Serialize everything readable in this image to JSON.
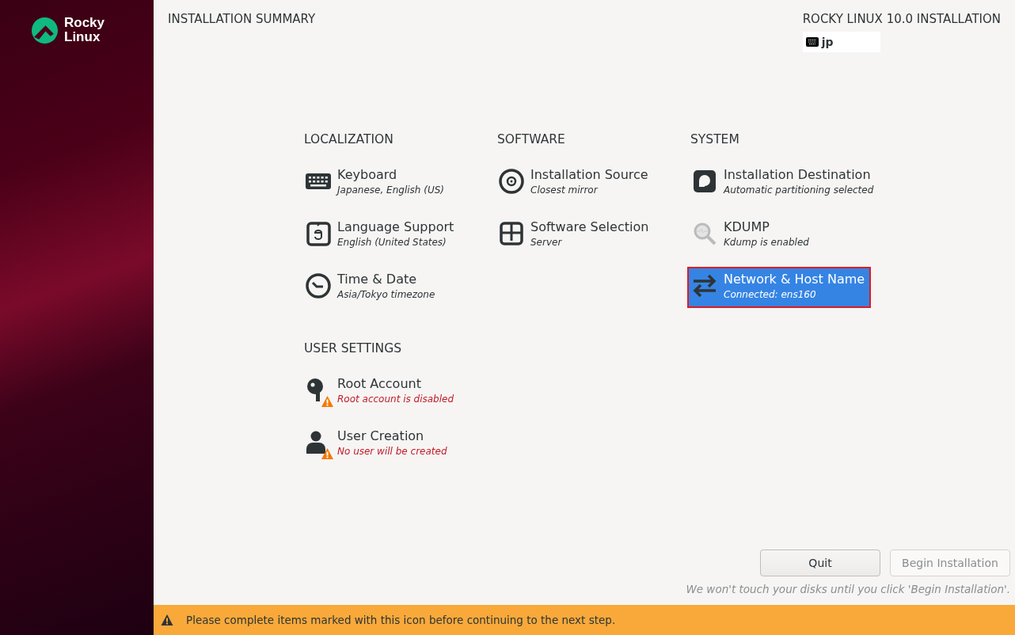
{
  "brand": {
    "line_1": "Rocky",
    "line_2": "Linux"
  },
  "header": {
    "title": "INSTALLATION SUMMARY",
    "product": "ROCKY LINUX 10.0 INSTALLATION",
    "keyboard_layout": "jp"
  },
  "sections": [
    {
      "title": "LOCALIZATION",
      "items": [
        {
          "kind": "keyboard",
          "title": "Keyboard",
          "status": "Japanese, English (US)",
          "warning": false,
          "selected": false
        },
        {
          "kind": "language",
          "title": "Language Support",
          "status": "English (United States)",
          "warning": false,
          "selected": false
        },
        {
          "kind": "clock",
          "title": "Time & Date",
          "status": "Asia/Tokyo timezone",
          "warning": false,
          "selected": false
        }
      ]
    },
    {
      "title": "SOFTWARE",
      "items": [
        {
          "kind": "source",
          "title": "Installation Source",
          "status": "Closest mirror",
          "warning": false,
          "selected": false
        },
        {
          "kind": "packages",
          "title": "Software Selection",
          "status": "Server",
          "warning": false,
          "selected": false
        }
      ]
    },
    {
      "title": "SYSTEM",
      "items": [
        {
          "kind": "disk",
          "title": "Installation Destination",
          "status": "Automatic partitioning selected",
          "warning": false,
          "selected": false
        },
        {
          "kind": "kdump",
          "title": "KDUMP",
          "status": "Kdump is enabled",
          "warning": false,
          "selected": false
        },
        {
          "kind": "network",
          "title": "Network & Host Name",
          "status": "Connected: ens160",
          "warning": false,
          "selected": true
        }
      ]
    },
    {
      "title": "USER SETTINGS",
      "items": [
        {
          "kind": "root",
          "title": "Root Account",
          "status": "Root account is disabled",
          "warning": true,
          "selected": false
        },
        {
          "kind": "user",
          "title": "User Creation",
          "status": "No user will be created",
          "warning": true,
          "selected": false
        }
      ]
    }
  ],
  "buttons": [
    {
      "label": "Quit",
      "disabled": false
    },
    {
      "label": "Begin Installation",
      "disabled": true
    }
  ],
  "footer_note": "We won't touch your disks until you click 'Begin Installation'.",
  "warning_bar": "Please complete items marked with this icon before continuing to the next step."
}
